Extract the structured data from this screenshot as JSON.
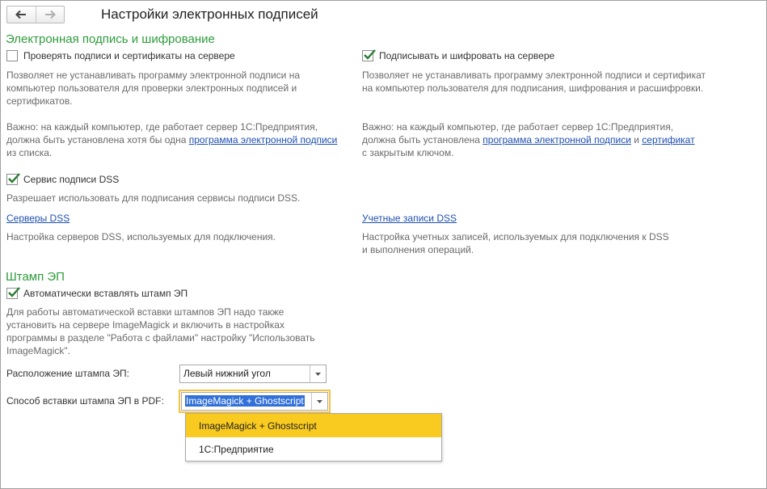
{
  "window": {
    "title": "Настройки электронных подписей"
  },
  "nav": {
    "back_icon": "arrow-left-icon",
    "forward_icon": "arrow-right-icon"
  },
  "section_signature": {
    "heading": "Электронная подпись и шифрование",
    "left": {
      "checkbox_label": "Проверять подписи и сертификаты на сервере",
      "checked": false,
      "desc": "Позволяет не устанавливать программу электронной подписи на компьютер пользователя для проверки электронных подписей и сертификатов.",
      "note_prefix": "Важно: на каждый компьютер, где работает сервер 1С:Предприятия, должна быть установлена хотя бы одна ",
      "note_link": "программа электронной подписи",
      "note_suffix": " из списка."
    },
    "right": {
      "checkbox_label": "Подписывать и шифровать на сервере",
      "checked": true,
      "desc": "Позволяет не устанавливать программу электронной подписи и сертификат на компьютер пользователя для подписания, шифрования и расшифровки.",
      "note_prefix": "Важно: на каждый компьютер, где работает сервер 1С:Предприятия, должна быть установлена ",
      "note_link1": "программа электронной подписи",
      "note_mid": " и ",
      "note_link2": "сертификат",
      "note_suffix": " с закрытым ключом."
    },
    "dss": {
      "checkbox_label": "Сервис подписи DSS",
      "checked": true,
      "desc": "Разрешает использовать для подписания сервисы подписи DSS.",
      "servers_link": "Серверы DSS",
      "servers_desc": "Настройка серверов DSS, используемых для подключения.",
      "accounts_link": "Учетные записи DSS",
      "accounts_desc": "Настройка учетных записей, используемых для подключения к DSS и выполнения операций."
    }
  },
  "section_stamp": {
    "heading": "Штамп ЭП",
    "auto_checkbox_label": "Автоматически вставлять штамп ЭП",
    "auto_checked": true,
    "desc": "Для работы автоматической вставки штампов ЭП надо также установить на сервере ImageMagick и включить в настройках программы в разделе \"Работа с файлами\" настройку \"Использовать ImageMagick\".",
    "position_label": "Расположение штампа ЭП:",
    "position_value": "Левый нижний угол",
    "method_label": "Способ вставки штампа ЭП в PDF:",
    "method_value": "ImageMagick + Ghostscript",
    "method_options": [
      "ImageMagick + Ghostscript",
      "1С:Предприятие"
    ]
  },
  "colors": {
    "section_heading": "#2e9c3c",
    "link": "#1f4fb0",
    "focus": "#f5c342",
    "option_highlight": "#f9cb20",
    "selection": "#3170d9"
  }
}
